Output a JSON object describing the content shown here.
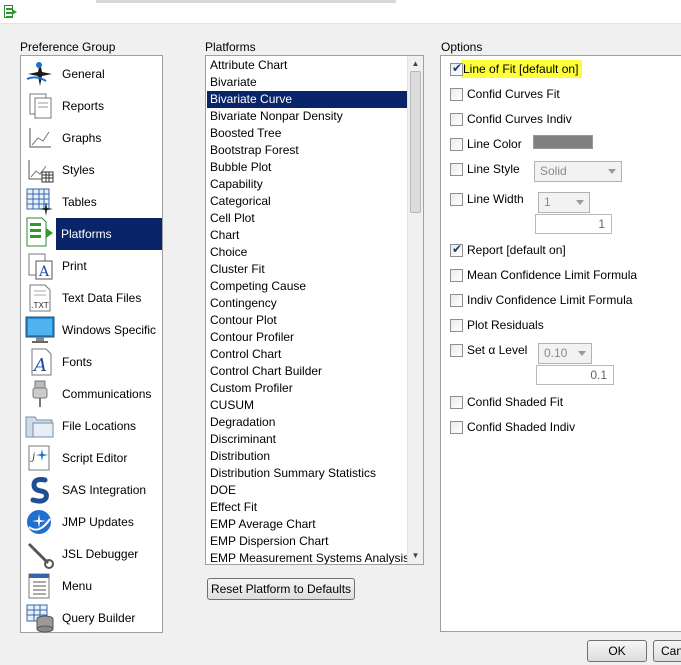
{
  "preference_group": {
    "label": "Preference Group",
    "items": [
      {
        "label": "General",
        "icon": "general-icon"
      },
      {
        "label": "Reports",
        "icon": "reports-icon"
      },
      {
        "label": "Graphs",
        "icon": "graphs-icon"
      },
      {
        "label": "Styles",
        "icon": "styles-icon"
      },
      {
        "label": "Tables",
        "icon": "tables-icon"
      },
      {
        "label": "Platforms",
        "icon": "platforms-icon",
        "selected": true
      },
      {
        "label": "Print",
        "icon": "print-icon"
      },
      {
        "label": "Text Data Files",
        "icon": "text-data-files-icon"
      },
      {
        "label": "Windows Specific",
        "icon": "windows-specific-icon"
      },
      {
        "label": "Fonts",
        "icon": "fonts-icon"
      },
      {
        "label": "Communications",
        "icon": "communications-icon"
      },
      {
        "label": "File Locations",
        "icon": "file-locations-icon"
      },
      {
        "label": "Script Editor",
        "icon": "script-editor-icon"
      },
      {
        "label": "SAS Integration",
        "icon": "sas-integration-icon"
      },
      {
        "label": "JMP Updates",
        "icon": "jmp-updates-icon"
      },
      {
        "label": "JSL Debugger",
        "icon": "jsl-debugger-icon"
      },
      {
        "label": "Menu",
        "icon": "menu-icon"
      },
      {
        "label": "Query Builder",
        "icon": "query-builder-icon"
      }
    ]
  },
  "platforms": {
    "label": "Platforms",
    "selected": "Bivariate Curve",
    "items": [
      "Attribute Chart",
      "Bivariate",
      "Bivariate Curve",
      "Bivariate Nonpar Density",
      "Boosted Tree",
      "Bootstrap Forest",
      "Bubble Plot",
      "Capability",
      "Categorical",
      "Cell Plot",
      "Chart",
      "Choice",
      "Cluster Fit",
      "Competing Cause",
      "Contingency",
      "Contour Plot",
      "Contour Profiler",
      "Control Chart",
      "Control Chart Builder",
      "Custom Profiler",
      "CUSUM",
      "Degradation",
      "Discriminant",
      "Distribution",
      "Distribution Summary Statistics",
      "DOE",
      "Effect Fit",
      "EMP Average Chart",
      "EMP Dispersion Chart",
      "EMP Measurement Systems Analysis"
    ],
    "reset_label": "Reset Platform to Defaults"
  },
  "options": {
    "label": "Options",
    "line_of_fit": {
      "label": "Line of Fit [default on]",
      "checked": true
    },
    "confid_curves_fit": {
      "label": "Confid Curves Fit",
      "checked": false
    },
    "confid_curves_indiv": {
      "label": "Confid Curves Indiv",
      "checked": false
    },
    "line_color": {
      "label": "Line Color",
      "checked": false,
      "color": "#808080"
    },
    "line_style": {
      "label": "Line Style",
      "checked": false,
      "value": "Solid"
    },
    "line_width": {
      "label": "Line Width",
      "checked": false,
      "value": "1",
      "number": "1"
    },
    "report": {
      "label": "Report [default on]",
      "checked": true
    },
    "mean_conf_limit": {
      "label": "Mean Confidence Limit Formula",
      "checked": false
    },
    "indiv_conf_limit": {
      "label": "Indiv Confidence Limit Formula",
      "checked": false
    },
    "plot_residuals": {
      "label": "Plot Residuals",
      "checked": false
    },
    "set_alpha_level": {
      "label": "Set α Level",
      "checked": false,
      "value": "0.10",
      "number": "0.1"
    },
    "confid_shaded_fit": {
      "label": "Confid Shaded Fit",
      "checked": false
    },
    "confid_shaded_indiv": {
      "label": "Confid Shaded Indiv",
      "checked": false
    }
  },
  "buttons": {
    "ok": "OK",
    "cancel": "Can"
  },
  "colors": {
    "selection": "#0a246a",
    "highlight": "#ffff3a"
  }
}
